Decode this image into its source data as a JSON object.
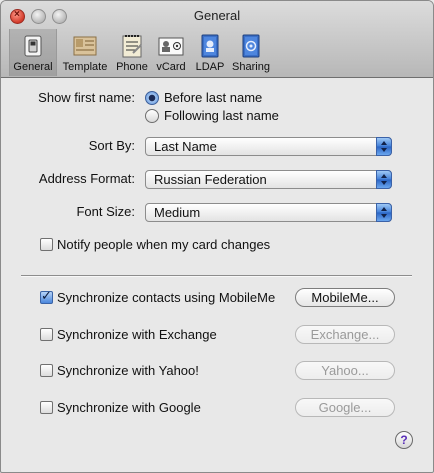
{
  "window": {
    "title": "General"
  },
  "toolbar": {
    "tabs": [
      {
        "label": "General",
        "icon": "switch-icon"
      },
      {
        "label": "Template",
        "icon": "template-card-icon"
      },
      {
        "label": "Phone",
        "icon": "notepad-phone-icon"
      },
      {
        "label": "vCard",
        "icon": "vcard-icon"
      },
      {
        "label": "LDAP",
        "icon": "ldap-book-icon"
      },
      {
        "label": "Sharing",
        "icon": "sharing-book-icon"
      }
    ]
  },
  "show_first_name": {
    "label": "Show first name:",
    "options": [
      "Before last name",
      "Following last name"
    ],
    "selected": "Before last name"
  },
  "sort_by": {
    "label": "Sort By:",
    "value": "Last Name"
  },
  "address_format": {
    "label": "Address Format:",
    "value": "Russian Federation"
  },
  "font_size": {
    "label": "Font Size:",
    "value": "Medium"
  },
  "notify": {
    "label": "Notify people when my card changes",
    "checked": false
  },
  "sync": [
    {
      "label": "Synchronize contacts using MobileMe",
      "checked": true,
      "button": "MobileMe...",
      "enabled": true
    },
    {
      "label": "Synchronize with Exchange",
      "checked": false,
      "button": "Exchange...",
      "enabled": false
    },
    {
      "label": "Synchronize with Yahoo!",
      "checked": false,
      "button": "Yahoo...",
      "enabled": false
    },
    {
      "label": "Synchronize with Google",
      "checked": false,
      "button": "Google...",
      "enabled": false
    }
  ],
  "help": {
    "label": "?"
  },
  "colors": {
    "accent": "#3f7ed8",
    "close_button": "#d23a2a"
  }
}
